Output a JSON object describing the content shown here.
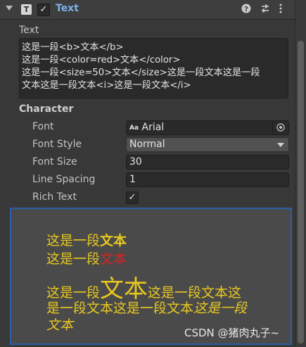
{
  "header": {
    "component_icon": "T",
    "enabled": "✓",
    "title": "Text"
  },
  "text_section": {
    "label": "Text",
    "lines": [
      "这是一段<b>文本</b>",
      "这是一段<color=red>文本</color>",
      "这是一段<size=50>文本</size>这是一段文本这是一段",
      "文本这是一段文本<i>这是一段文本</i>"
    ]
  },
  "character": {
    "title": "Character",
    "font_label": "Font",
    "font_value": "Arial",
    "font_prefix": "Aa",
    "font_style_label": "Font Style",
    "font_style_value": "Normal",
    "font_size_label": "Font Size",
    "font_size_value": "30",
    "line_spacing_label": "Line Spacing",
    "line_spacing_value": "1",
    "rich_text_label": "Rich Text",
    "rich_text_checked": "✓"
  },
  "preview": {
    "line1_a": "这是一段",
    "line1_b": "文本",
    "line2_a": "这是一段",
    "line2_b": "文本",
    "line3_a": "这是一段",
    "line3_b": "文本",
    "line3_c": "这是一段文本这",
    "line4_a": "是一段文本这是一段文本",
    "line4_b": "这是一段",
    "line5": "文本"
  },
  "watermark": "CSDN @猪肉丸子~",
  "colors": {
    "accent": "#7fb0e8",
    "preview_text": "#e8c820",
    "preview_red": "#e02020",
    "selection_border": "#2b5fa8"
  }
}
